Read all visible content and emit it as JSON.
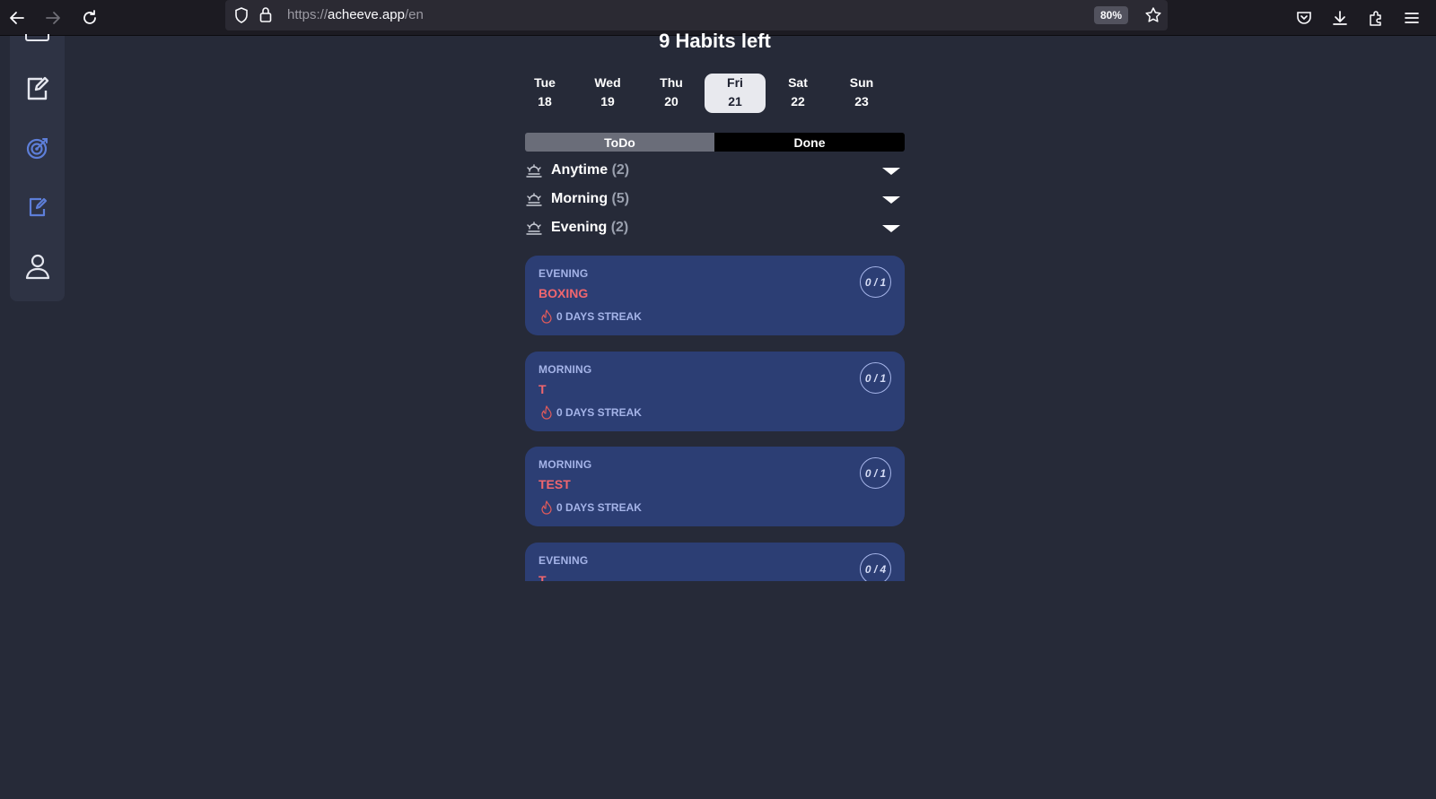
{
  "browser": {
    "url_prefix": "https://",
    "url_host": "acheeve.app",
    "url_path": "/en",
    "zoom": "80%"
  },
  "sidebar": {
    "items": [
      {
        "icon": "edit-note-icon"
      },
      {
        "icon": "target-icon"
      },
      {
        "icon": "edit-note-small-icon"
      },
      {
        "icon": "user-icon"
      }
    ]
  },
  "main": {
    "heading": "9 Habits left",
    "days": [
      {
        "name": "Tue",
        "num": "18"
      },
      {
        "name": "Wed",
        "num": "19"
      },
      {
        "name": "Thu",
        "num": "20"
      },
      {
        "name": "Fri",
        "num": "21",
        "active": true
      },
      {
        "name": "Sat",
        "num": "22"
      },
      {
        "name": "Sun",
        "num": "23"
      }
    ],
    "tabs": {
      "todo": "ToDo",
      "done": "Done"
    },
    "groups": [
      {
        "label": "Anytime",
        "count": "(2)"
      },
      {
        "label": "Morning",
        "count": "(5)"
      },
      {
        "label": "Evening",
        "count": "(2)"
      }
    ],
    "cards": [
      {
        "period": "EVENING",
        "title": "BOXING",
        "streak": "0 DAYS STREAK",
        "progress": "0 / 1"
      },
      {
        "period": "MORNING",
        "title": "T",
        "streak": "0 DAYS STREAK",
        "progress": "0 / 1"
      },
      {
        "period": "MORNING",
        "title": "TEST",
        "streak": "0 DAYS STREAK",
        "progress": "0 / 1"
      },
      {
        "period": "EVENING",
        "title": "T",
        "streak": "",
        "progress": "0 / 4"
      }
    ],
    "colors": {
      "accent_title": "#f0666e",
      "card_bg": "#2c3e74",
      "bg": "#262a38"
    }
  }
}
